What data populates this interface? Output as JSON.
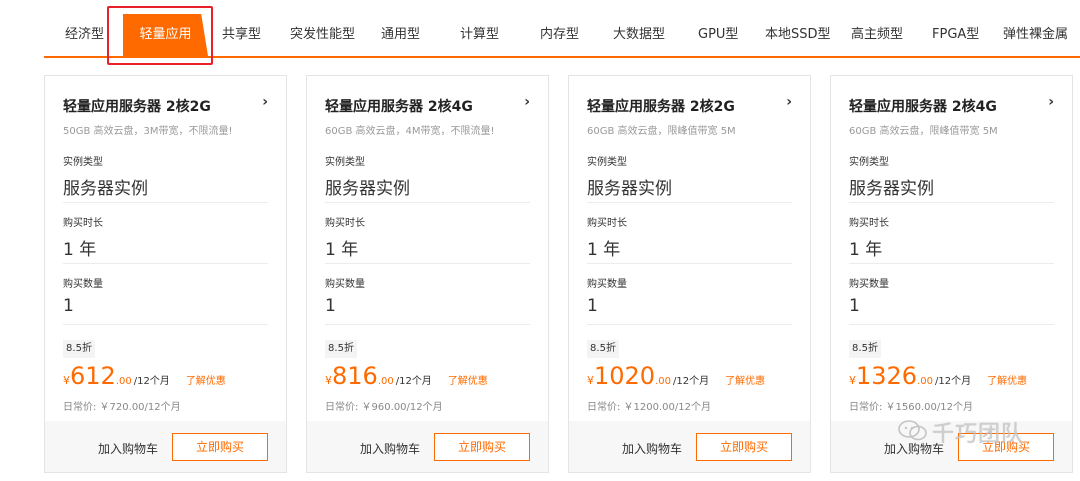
{
  "tabs": [
    "经济型",
    "轻量应用",
    "共享型",
    "突发性能型",
    "通用型",
    "计算型",
    "内存型",
    "大数据型",
    "GPU型",
    "本地SSD型",
    "高主频型",
    "FPGA型",
    "弹性裸金属"
  ],
  "active_tab": "轻量应用",
  "labels": {
    "instance_type": "实例类型",
    "duration": "购买时长",
    "quantity": "购买数量",
    "currency": "¥",
    "learn_offer": "了解优惠",
    "add_to_cart": "加入购物车",
    "buy_now": "立即购买"
  },
  "cards": [
    {
      "title": "轻量应用服务器 2核2G",
      "desc": "50GB 高效云盘，3M带宽，不限流量!",
      "instance_type": "服务器实例",
      "duration": "1 年",
      "quantity": "1",
      "discount": "8.5折",
      "price_int": "612",
      "price_dec": ".00",
      "period": "/12个月",
      "list_price": "日常价: ￥720.00/12个月"
    },
    {
      "title": "轻量应用服务器 2核4G",
      "desc": "60GB 高效云盘，4M带宽，不限流量!",
      "instance_type": "服务器实例",
      "duration": "1 年",
      "quantity": "1",
      "discount": "8.5折",
      "price_int": "816",
      "price_dec": ".00",
      "period": "/12个月",
      "list_price": "日常价: ￥960.00/12个月"
    },
    {
      "title": "轻量应用服务器 2核2G",
      "desc": "60GB 高效云盘，限峰值带宽 5M",
      "instance_type": "服务器实例",
      "duration": "1 年",
      "quantity": "1",
      "discount": "8.5折",
      "price_int": "1020",
      "price_dec": ".00",
      "period": "/12个月",
      "list_price": "日常价: ￥1200.00/12个月"
    },
    {
      "title": "轻量应用服务器 2核4G",
      "desc": "60GB 高效云盘，限峰值带宽 5M",
      "instance_type": "服务器实例",
      "duration": "1 年",
      "quantity": "1",
      "discount": "8.5折",
      "price_int": "1326",
      "price_dec": ".00",
      "period": "/12个月",
      "list_price": "日常价: ￥1560.00/12个月"
    }
  ],
  "watermark": "千巧团队",
  "colors": {
    "accent": "#ff6a00",
    "highlight_box": "#e8202a"
  },
  "icons": {
    "card_arrow": "chevron-right-icon",
    "watermark_icon": "wechat-icon"
  }
}
